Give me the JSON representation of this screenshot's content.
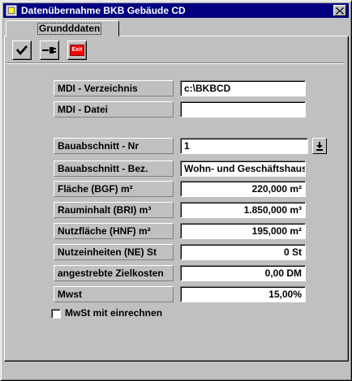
{
  "window": {
    "title": "Datenübernahme  BKB Gebäude CD",
    "close_label": "×"
  },
  "tab": {
    "label": "Grundddaten"
  },
  "toolbar": {
    "exit_label": "Exit"
  },
  "fields": {
    "mdi_verzeichnis": {
      "label": "MDI - Verzeichnis",
      "value": "c:\\BKBCD"
    },
    "mdi_datei": {
      "label": "MDI - Datei",
      "value": ""
    },
    "bauabschnitt_nr": {
      "label": "Bauabschnitt - Nr",
      "value": "1"
    },
    "bauabschnitt_bez": {
      "label": "Bauabschnitt - Bez.",
      "value": "Wohn- und Geschäftshaus"
    },
    "flaeche": {
      "label": "Fläche (BGF) m²",
      "value": "220,000 m²"
    },
    "rauminhalt": {
      "label": "Rauminhalt (BRI) m³",
      "value": "1.850,000 m³"
    },
    "nutzflaeche": {
      "label": "Nutzfläche (HNF) m²",
      "value": "195,000 m²"
    },
    "nutzeinheiten": {
      "label": "Nutzeinheiten (NE) St",
      "value": "0 St"
    },
    "zielkosten": {
      "label": "angestrebte Zielkosten",
      "value": "0,00 DM"
    },
    "mwst": {
      "label": "Mwst",
      "value": "15,00%"
    }
  },
  "checkbox": {
    "label": "MwSt mit einrechnen",
    "checked": false
  },
  "colors": {
    "titlebar": "#000080",
    "face": "#c0c0c0",
    "exit_red": "#ff0000"
  }
}
